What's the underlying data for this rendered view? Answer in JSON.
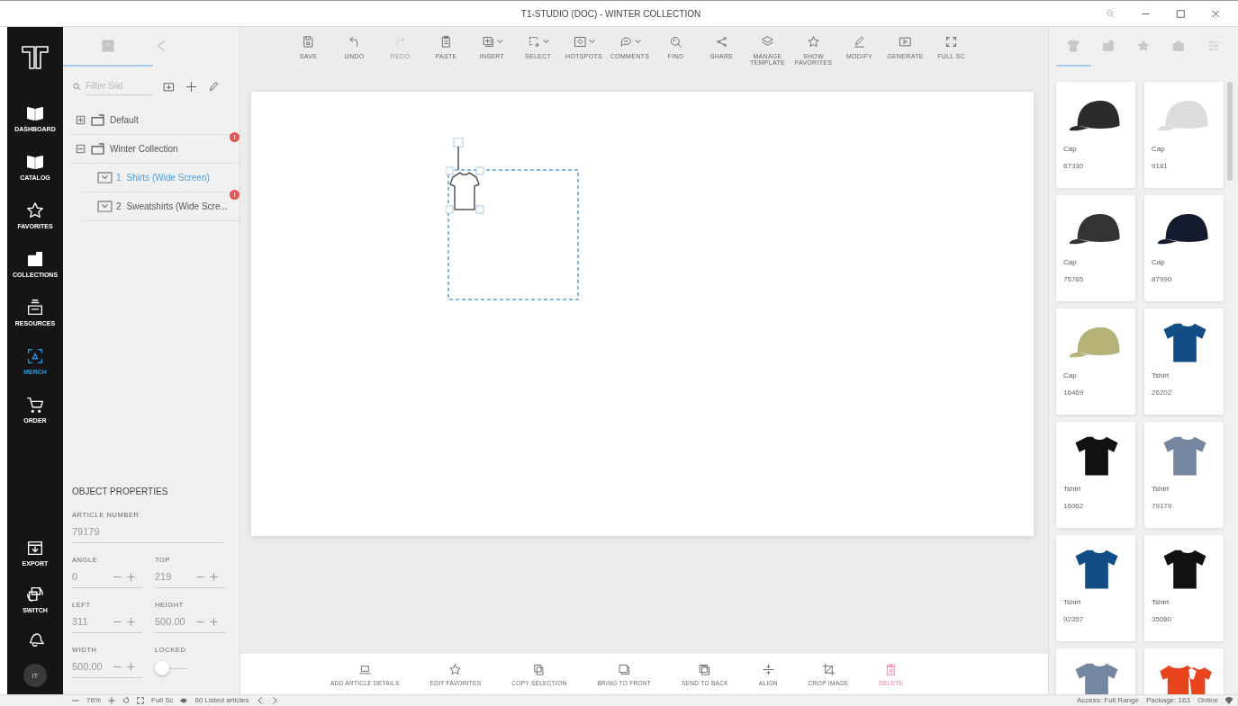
{
  "window": {
    "title": "T1-STUDIO (DOC) - WINTER COLLECTION"
  },
  "nav": {
    "items": [
      {
        "label": "DASHBOARD",
        "selected": false
      },
      {
        "label": "CATALOG",
        "selected": false
      },
      {
        "label": "FAVORITES",
        "selected": false
      },
      {
        "label": "COLLECTIONS",
        "selected": false
      },
      {
        "label": "RESOURCES",
        "selected": false
      },
      {
        "label": "MERCH",
        "selected": true
      },
      {
        "label": "ORDER",
        "selected": false
      }
    ],
    "bottom_items": [
      {
        "label": "EXPORT"
      },
      {
        "label": "SWITCH"
      }
    ],
    "avatar": "IT"
  },
  "slides_panel": {
    "tabs": [
      {
        "selected": true
      },
      {
        "selected": false
      }
    ],
    "search": {
      "placeholder": "Filter Slid"
    },
    "tree": [
      {
        "label": "Default",
        "expanded": false,
        "selected": false
      },
      {
        "label": "Winter Collection",
        "expanded": true,
        "selected": false,
        "badge": "!",
        "children": [
          {
            "number": "1",
            "label": "Shirts (Wide Screen)",
            "selected": true
          },
          {
            "number": "2",
            "label": "Sweatshirts (Wide Scre...",
            "selected": false,
            "badge": "!"
          }
        ]
      }
    ]
  },
  "object_properties": {
    "title": "OBJECT PROPERTIES",
    "article_number": {
      "label": "ARTICLE NUMBER",
      "value": "79179"
    },
    "fields": [
      {
        "label": "ANGLE",
        "value": "0"
      },
      {
        "label": "TOP",
        "value": "219"
      },
      {
        "label": "LEFT",
        "value": "311"
      },
      {
        "label": "HEIGHT",
        "value": "500.00"
      },
      {
        "label": "WIDTH",
        "value": "500.00"
      }
    ],
    "locked": {
      "label": "LOCKED",
      "on": false
    }
  },
  "toolbar": [
    {
      "label": "SAVE",
      "disabled": false,
      "dropdown": false
    },
    {
      "label": "UNDO",
      "disabled": false,
      "dropdown": false
    },
    {
      "label": "REDO",
      "disabled": true,
      "dropdown": false
    },
    {
      "label": "PASTE",
      "disabled": false,
      "dropdown": false
    },
    {
      "label": "INSERT",
      "disabled": false,
      "dropdown": true
    },
    {
      "label": "SELECT",
      "disabled": false,
      "dropdown": true
    },
    {
      "label": "HOTSPOTS",
      "disabled": false,
      "dropdown": true
    },
    {
      "label": "COMMENTS",
      "disabled": false,
      "dropdown": true
    },
    {
      "label": "FIND",
      "disabled": false,
      "dropdown": false
    },
    {
      "label": "SHARE",
      "disabled": false,
      "dropdown": false
    },
    {
      "label": "MANAGE TEMPLATE",
      "disabled": false,
      "dropdown": false
    },
    {
      "label": "SHOW FAVORITES",
      "disabled": false,
      "dropdown": false
    },
    {
      "label": "MODIFY",
      "disabled": false,
      "dropdown": false
    },
    {
      "label": "GENERATE",
      "disabled": false,
      "dropdown": false
    },
    {
      "label": "FULL SC",
      "disabled": false,
      "dropdown": false
    }
  ],
  "actions": [
    {
      "label": "ADD ARTICLE DETAILS",
      "kind": "normal"
    },
    {
      "label": "EDIT FAVORITES",
      "kind": "normal"
    },
    {
      "label": "COPY SELECTION",
      "kind": "normal"
    },
    {
      "label": "BRING TO FRONT",
      "kind": "normal"
    },
    {
      "label": "SEND TO BACK",
      "kind": "normal"
    },
    {
      "label": "ALIGN",
      "kind": "normal"
    },
    {
      "label": "CROP IMAGE",
      "kind": "normal"
    },
    {
      "label": "DELETE",
      "kind": "danger"
    }
  ],
  "articles_panel": {
    "tabs": [
      {
        "selected": true
      },
      {
        "selected": false
      },
      {
        "selected": false
      },
      {
        "selected": false
      },
      {
        "selected": false
      }
    ],
    "items": [
      {
        "kind": "cap",
        "color": "#2b2b2b",
        "name": "Cap",
        "number": "67330"
      },
      {
        "kind": "cap",
        "color": "#dcdcdc",
        "name": "Cap",
        "number": "9181"
      },
      {
        "kind": "cap",
        "color": "#333333",
        "name": "Cap",
        "number": "75765"
      },
      {
        "kind": "cap",
        "color": "#151a2e",
        "name": "Cap",
        "number": "87990"
      },
      {
        "kind": "cap",
        "color": "#b5b177",
        "name": "Cap",
        "number": "16469"
      },
      {
        "kind": "tshirt",
        "color": "#124d86",
        "name": "Tshirt",
        "number": "26202"
      },
      {
        "kind": "tshirt",
        "color": "#111111",
        "name": "Tshirt",
        "number": "16062"
      },
      {
        "kind": "tshirt",
        "color": "#7486a0",
        "name": "Tshirt",
        "number": "79179"
      },
      {
        "kind": "tshirt",
        "color": "#124d86",
        "name": "Tshirt",
        "number": "92357"
      },
      {
        "kind": "tshirt",
        "color": "#111111",
        "name": "Tshirt",
        "number": "35080"
      },
      {
        "kind": "tshirt",
        "color": "#7486a0"
      },
      {
        "kind": "polo",
        "color": "#e8451e"
      }
    ]
  },
  "status_bar": {
    "zoom": "76%",
    "full_screen": "Full Sc",
    "listed": "60 Listed articles",
    "access": "Access: Full Range",
    "package": "Package: 163",
    "connection": "Online"
  }
}
